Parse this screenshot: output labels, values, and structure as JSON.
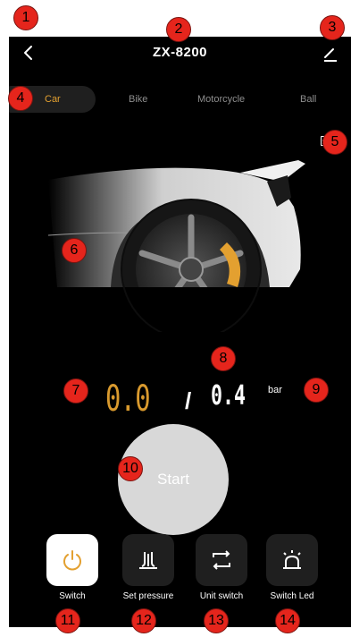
{
  "header": {
    "title": "ZX-8200"
  },
  "tabs": [
    {
      "label": "Car",
      "active": true
    },
    {
      "label": "Bike",
      "active": false
    },
    {
      "label": "Motorcycle",
      "active": false
    },
    {
      "label": "Ball",
      "active": false
    }
  ],
  "battery": {
    "level": "100"
  },
  "gauge": {
    "current": "0.0",
    "separator": "/",
    "target": "0.4",
    "unit": "bar"
  },
  "start": {
    "label": "Start"
  },
  "controls": [
    {
      "label": "Switch",
      "icon": "power-icon"
    },
    {
      "label": "Set pressure",
      "icon": "pressure-icon"
    },
    {
      "label": "Unit switch",
      "icon": "switch-arrows-icon"
    },
    {
      "label": "Switch Led",
      "icon": "led-light-icon"
    }
  ],
  "annotations": [
    "1",
    "2",
    "3",
    "4",
    "5",
    "6",
    "7",
    "8",
    "9",
    "10",
    "11",
    "12",
    "13",
    "14"
  ],
  "colors": {
    "accent": "#d99a2e",
    "background": "#000000",
    "badge": "#e5251c"
  }
}
